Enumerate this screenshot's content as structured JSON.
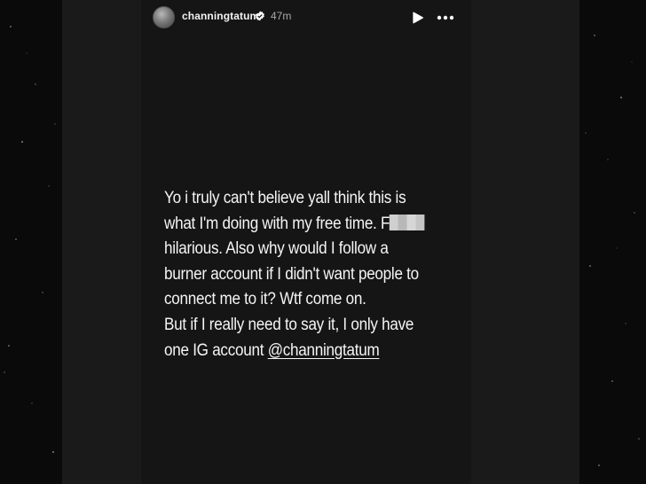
{
  "header": {
    "username": "channingtatum",
    "timestamp": "47m",
    "verified_icon": "verified-badge-icon",
    "play_icon": "play-icon",
    "more_icon": "more-options-icon"
  },
  "caption": {
    "line1": "Yo i truly can't believe yall think this is",
    "line2_prefix": "what I'm doing with my free time. F",
    "line3": "hilarious. Also why would I follow a",
    "line4": "burner account if I didn't want people to",
    "line5": "connect me to it? Wtf come on.",
    "line6": "But if I really need to say it, I only have",
    "line7_prefix": "one IG account ",
    "mention": "@channingtatum"
  },
  "colors": {
    "background": "#0a0a0a",
    "panel": "#1a1a1a",
    "story": "#151515",
    "text": "#f5f5f5",
    "muted": "#a8a8a8",
    "verified": "#ffffff"
  }
}
